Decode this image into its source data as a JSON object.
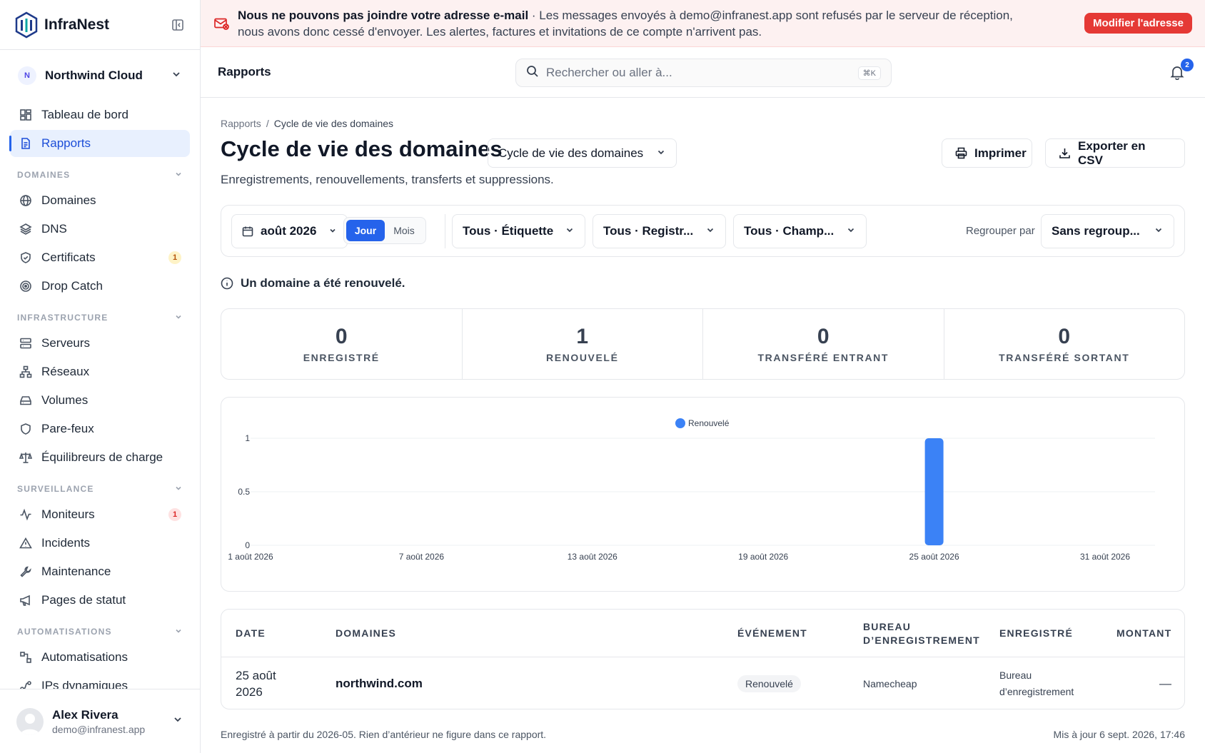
{
  "app": {
    "name": "InfraNest"
  },
  "org": {
    "initial": "N",
    "name": "Northwind Cloud"
  },
  "nav": {
    "top": [
      {
        "label": "Tableau de bord",
        "icon": "dashboard-icon"
      },
      {
        "label": "Rapports",
        "icon": "report-icon",
        "active": true
      }
    ],
    "sections": [
      {
        "title": "DOMAINES",
        "items": [
          {
            "label": "Domaines",
            "icon": "globe-icon"
          },
          {
            "label": "DNS",
            "icon": "layers-icon"
          },
          {
            "label": "Certificats",
            "icon": "shield-check-icon",
            "badge": "1",
            "badge_color": "yellow"
          },
          {
            "label": "Drop Catch",
            "icon": "target-icon"
          }
        ]
      },
      {
        "title": "INFRASTRUCTURE",
        "items": [
          {
            "label": "Serveurs",
            "icon": "server-icon"
          },
          {
            "label": "Réseaux",
            "icon": "network-icon"
          },
          {
            "label": "Volumes",
            "icon": "hard-drive-icon"
          },
          {
            "label": "Pare-feux",
            "icon": "shield-icon"
          },
          {
            "label": "Équilibreurs de charge",
            "icon": "scale-icon"
          }
        ]
      },
      {
        "title": "SURVEILLANCE",
        "items": [
          {
            "label": "Moniteurs",
            "icon": "activity-icon",
            "badge": "1",
            "badge_color": "red"
          },
          {
            "label": "Incidents",
            "icon": "alert-triangle-icon"
          },
          {
            "label": "Maintenance",
            "icon": "wrench-icon"
          },
          {
            "label": "Pages de statut",
            "icon": "megaphone-icon"
          }
        ]
      },
      {
        "title": "AUTOMATISATIONS",
        "items": [
          {
            "label": "Automatisations",
            "icon": "workflow-icon"
          },
          {
            "label": "IPs dynamiques",
            "icon": "dynamic-ip-icon"
          }
        ]
      }
    ]
  },
  "user": {
    "name": "Alex Rivera",
    "email": "demo@infranest.app"
  },
  "banner": {
    "title": "Nous ne pouvons pas joindre votre adresse e-mail",
    "message": " · Les messages envoyés à demo@infranest.app sont refusés par le serveur de réception, nous avons donc cessé d'envoyer. Les alertes, factures et invitations de ce compte n'arrivent pas.",
    "button": "Modifier l'adresse"
  },
  "topbar": {
    "title": "Rapports",
    "search_placeholder": "Rechercher ou aller à...",
    "shortcut": "⌘K",
    "notifications": "2"
  },
  "breadcrumb": {
    "root": "Rapports",
    "separator": "/",
    "current": "Cycle de vie des domaines"
  },
  "page": {
    "title": "Cycle de vie des domaines",
    "report_select": "Cycle de vie des domaines",
    "print": "Imprimer",
    "export": "Exporter en CSV",
    "subtitle": "Enregistrements, renouvellements, transferts et suppressions."
  },
  "filters": {
    "month": "août 2026",
    "granularity": [
      "Jour",
      "Mois"
    ],
    "granularity_selected": "Jour",
    "tag": "Tous · Étiquette",
    "registrar": "Tous · Registr...",
    "field": "Tous · Champ...",
    "group_label": "Regrouper par",
    "group_value": "Sans regroup..."
  },
  "info": "Un domaine a été renouvelé.",
  "stats": [
    {
      "value": "0",
      "label": "ENREGISTRÉ"
    },
    {
      "value": "1",
      "label": "RENOUVELÉ"
    },
    {
      "value": "0",
      "label": "TRANSFÉRÉ ENTRANT"
    },
    {
      "value": "0",
      "label": "TRANSFÉRÉ SORTANT"
    }
  ],
  "chart_data": {
    "type": "bar",
    "categories": [
      "1 août 2026",
      "2 août 2026",
      "3 août 2026",
      "4 août 2026",
      "5 août 2026",
      "6 août 2026",
      "7 août 2026",
      "8 août 2026",
      "9 août 2026",
      "10 août 2026",
      "11 août 2026",
      "12 août 2026",
      "13 août 2026",
      "14 août 2026",
      "15 août 2026",
      "16 août 2026",
      "17 août 2026",
      "18 août 2026",
      "19 août 2026",
      "20 août 2026",
      "21 août 2026",
      "22 août 2026",
      "23 août 2026",
      "24 août 2026",
      "25 août 2026",
      "26 août 2026",
      "27 août 2026",
      "28 août 2026",
      "29 août 2026",
      "30 août 2026",
      "31 août 2026"
    ],
    "x_tick_labels": [
      "1 août 2026",
      "7 août 2026",
      "13 août 2026",
      "19 août 2026",
      "25 août 2026",
      "31 août 2026"
    ],
    "series": [
      {
        "name": "Renouvelé",
        "color": "#3b82f6",
        "values": [
          0,
          0,
          0,
          0,
          0,
          0,
          0,
          0,
          0,
          0,
          0,
          0,
          0,
          0,
          0,
          0,
          0,
          0,
          0,
          0,
          0,
          0,
          0,
          0,
          1,
          0,
          0,
          0,
          0,
          0,
          0
        ]
      }
    ],
    "y_ticks": [
      "0",
      "0.5",
      "1"
    ],
    "ylim": [
      0,
      1
    ],
    "grid": true,
    "legend": "top-center"
  },
  "table": {
    "headers": {
      "date": "DATE",
      "domains": "DOMAINES",
      "event": "ÉVÉNEMENT",
      "registrar_line1": "BUREAU",
      "registrar_line2": "D’ENREGISTREMENT",
      "registered": "ENREGISTRÉ",
      "amount": "MONTANT"
    },
    "rows": [
      {
        "date_line1": "25 août",
        "date_line2": "2026",
        "domain": "northwind.com",
        "event": "Renouvelé",
        "registrar": "Namecheap",
        "registered_line1": "Bureau",
        "registered_line2": "d’enregistrement",
        "amount": "—"
      }
    ]
  },
  "footer": {
    "note": "Enregistré à partir du 2026-05. Rien d’antérieur ne figure dans ce rapport.",
    "updated": "Mis à jour 6 sept. 2026, 17:46"
  }
}
